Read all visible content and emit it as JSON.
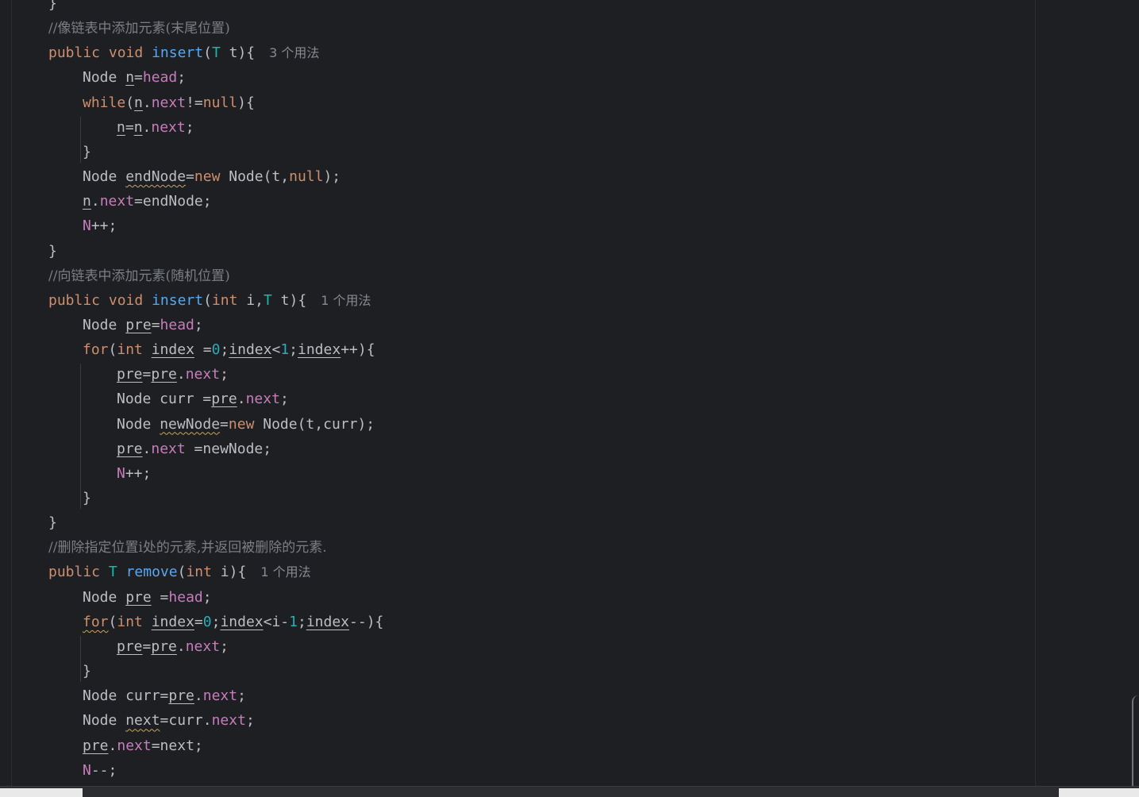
{
  "editor": {
    "lines": [
      {
        "indent": 1,
        "tokens": [
          {
            "t": "}",
            "c": ""
          }
        ]
      },
      {
        "indent": 1,
        "tokens": [
          {
            "t": "//像链表中添加元素(末尾位置)",
            "c": "cm"
          }
        ]
      },
      {
        "indent": 1,
        "tokens": [
          {
            "t": "public",
            "c": "kw"
          },
          {
            "t": " "
          },
          {
            "t": "void",
            "c": "kw"
          },
          {
            "t": " "
          },
          {
            "t": "insert",
            "c": "fn"
          },
          {
            "t": "("
          },
          {
            "t": "T",
            "c": "type"
          },
          {
            "t": " t){"
          }
        ],
        "hint": "3 个用法"
      },
      {
        "indent": 2,
        "tokens": [
          {
            "t": "Node "
          },
          {
            "t": "n",
            "c": "ul"
          },
          {
            "t": "="
          },
          {
            "t": "head",
            "c": "field"
          },
          {
            "t": ";"
          }
        ]
      },
      {
        "indent": 2,
        "tokens": [
          {
            "t": "while",
            "c": "kw"
          },
          {
            "t": "("
          },
          {
            "t": "n",
            "c": "ul"
          },
          {
            "t": "."
          },
          {
            "t": "next",
            "c": "field"
          },
          {
            "t": "!="
          },
          {
            "t": "null",
            "c": "kw"
          },
          {
            "t": "){"
          }
        ]
      },
      {
        "indent": 3,
        "tokens": [
          {
            "t": "n",
            "c": "ul"
          },
          {
            "t": "="
          },
          {
            "t": "n",
            "c": "ul"
          },
          {
            "t": "."
          },
          {
            "t": "next",
            "c": "field"
          },
          {
            "t": ";"
          }
        ]
      },
      {
        "indent": 2,
        "tokens": [
          {
            "t": "}"
          }
        ]
      },
      {
        "indent": 2,
        "tokens": [
          {
            "t": "Node "
          },
          {
            "t": "endNode",
            "c": "wavy"
          },
          {
            "t": "="
          },
          {
            "t": "new",
            "c": "kw"
          },
          {
            "t": " Node(t,"
          },
          {
            "t": "null",
            "c": "kw"
          },
          {
            "t": ");"
          }
        ]
      },
      {
        "indent": 2,
        "tokens": [
          {
            "t": "n",
            "c": "ul"
          },
          {
            "t": "."
          },
          {
            "t": "next",
            "c": "field"
          },
          {
            "t": "=endNode;"
          }
        ]
      },
      {
        "indent": 2,
        "tokens": [
          {
            "t": "N",
            "c": "field"
          },
          {
            "t": "++;"
          }
        ]
      },
      {
        "indent": 1,
        "tokens": [
          {
            "t": "}"
          }
        ]
      },
      {
        "indent": 1,
        "tokens": [
          {
            "t": "//向链表中添加元素(随机位置)",
            "c": "cm"
          }
        ]
      },
      {
        "indent": 1,
        "tokens": [
          {
            "t": "public",
            "c": "kw"
          },
          {
            "t": " "
          },
          {
            "t": "void",
            "c": "kw"
          },
          {
            "t": " "
          },
          {
            "t": "insert",
            "c": "fn"
          },
          {
            "t": "("
          },
          {
            "t": "int",
            "c": "kw"
          },
          {
            "t": " i,"
          },
          {
            "t": "T",
            "c": "type"
          },
          {
            "t": " t){"
          }
        ],
        "hint": "1 个用法"
      },
      {
        "indent": 2,
        "tokens": [
          {
            "t": "Node "
          },
          {
            "t": "pre",
            "c": "ul"
          },
          {
            "t": "="
          },
          {
            "t": "head",
            "c": "field"
          },
          {
            "t": ";"
          }
        ]
      },
      {
        "indent": 2,
        "tokens": [
          {
            "t": "for",
            "c": "kw"
          },
          {
            "t": "("
          },
          {
            "t": "int",
            "c": "kw"
          },
          {
            "t": " "
          },
          {
            "t": "index",
            "c": "ul"
          },
          {
            "t": " ="
          },
          {
            "t": "0",
            "c": "num"
          },
          {
            "t": ";"
          },
          {
            "t": "index",
            "c": "ul"
          },
          {
            "t": "<"
          },
          {
            "t": "1",
            "c": "num"
          },
          {
            "t": ";"
          },
          {
            "t": "index",
            "c": "ul"
          },
          {
            "t": "++){"
          }
        ]
      },
      {
        "indent": 3,
        "tokens": [
          {
            "t": "pre",
            "c": "ul"
          },
          {
            "t": "="
          },
          {
            "t": "pre",
            "c": "ul"
          },
          {
            "t": "."
          },
          {
            "t": "next",
            "c": "field"
          },
          {
            "t": ";"
          }
        ]
      },
      {
        "indent": 3,
        "tokens": [
          {
            "t": "Node curr ="
          },
          {
            "t": "pre",
            "c": "ul"
          },
          {
            "t": "."
          },
          {
            "t": "next",
            "c": "field"
          },
          {
            "t": ";"
          }
        ]
      },
      {
        "indent": 3,
        "tokens": [
          {
            "t": "Node "
          },
          {
            "t": "newNode",
            "c": "wavy"
          },
          {
            "t": "="
          },
          {
            "t": "new",
            "c": "kw"
          },
          {
            "t": " Node(t,curr);"
          }
        ]
      },
      {
        "indent": 3,
        "tokens": [
          {
            "t": "pre",
            "c": "ul"
          },
          {
            "t": "."
          },
          {
            "t": "next",
            "c": "field"
          },
          {
            "t": " =newNode;"
          }
        ]
      },
      {
        "indent": 3,
        "tokens": [
          {
            "t": "N",
            "c": "field"
          },
          {
            "t": "++;"
          }
        ]
      },
      {
        "indent": 2,
        "tokens": [
          {
            "t": "}"
          }
        ]
      },
      {
        "indent": 1,
        "tokens": [
          {
            "t": "}"
          }
        ]
      },
      {
        "indent": 1,
        "tokens": [
          {
            "t": "//删除指定位置i处的元素,并返回被删除的元素.",
            "c": "cm"
          }
        ]
      },
      {
        "indent": 1,
        "tokens": [
          {
            "t": "public",
            "c": "kw"
          },
          {
            "t": " "
          },
          {
            "t": "T",
            "c": "type"
          },
          {
            "t": " "
          },
          {
            "t": "remove",
            "c": "fn"
          },
          {
            "t": "("
          },
          {
            "t": "int",
            "c": "kw"
          },
          {
            "t": " i){"
          }
        ],
        "hint": "1 个用法"
      },
      {
        "indent": 2,
        "tokens": [
          {
            "t": "Node "
          },
          {
            "t": "pre",
            "c": "ul"
          },
          {
            "t": " ="
          },
          {
            "t": "head",
            "c": "field"
          },
          {
            "t": ";"
          }
        ]
      },
      {
        "indent": 2,
        "tokens": [
          {
            "t": "for",
            "c": "kw wavy"
          },
          {
            "t": "("
          },
          {
            "t": "int",
            "c": "kw"
          },
          {
            "t": " "
          },
          {
            "t": "index",
            "c": "ul"
          },
          {
            "t": "="
          },
          {
            "t": "0",
            "c": "num"
          },
          {
            "t": ";"
          },
          {
            "t": "index",
            "c": "ul"
          },
          {
            "t": "<i-"
          },
          {
            "t": "1",
            "c": "num"
          },
          {
            "t": ";"
          },
          {
            "t": "index",
            "c": "ul"
          },
          {
            "t": "--){"
          }
        ]
      },
      {
        "indent": 3,
        "tokens": [
          {
            "t": "pre",
            "c": "ul"
          },
          {
            "t": "="
          },
          {
            "t": "pre",
            "c": "ul"
          },
          {
            "t": "."
          },
          {
            "t": "next",
            "c": "field"
          },
          {
            "t": ";"
          }
        ]
      },
      {
        "indent": 2,
        "tokens": [
          {
            "t": "}"
          }
        ]
      },
      {
        "indent": 2,
        "tokens": [
          {
            "t": "Node curr="
          },
          {
            "t": "pre",
            "c": "ul"
          },
          {
            "t": "."
          },
          {
            "t": "next",
            "c": "field"
          },
          {
            "t": ";"
          }
        ]
      },
      {
        "indent": 2,
        "tokens": [
          {
            "t": "Node "
          },
          {
            "t": "next",
            "c": "wavy"
          },
          {
            "t": "=curr."
          },
          {
            "t": "next",
            "c": "field"
          },
          {
            "t": ";"
          }
        ]
      },
      {
        "indent": 2,
        "tokens": [
          {
            "t": "pre",
            "c": "ul"
          },
          {
            "t": "."
          },
          {
            "t": "next",
            "c": "field"
          },
          {
            "t": "=next;"
          }
        ]
      },
      {
        "indent": 2,
        "tokens": [
          {
            "t": "N",
            "c": "field"
          },
          {
            "t": "--;"
          }
        ]
      }
    ]
  }
}
